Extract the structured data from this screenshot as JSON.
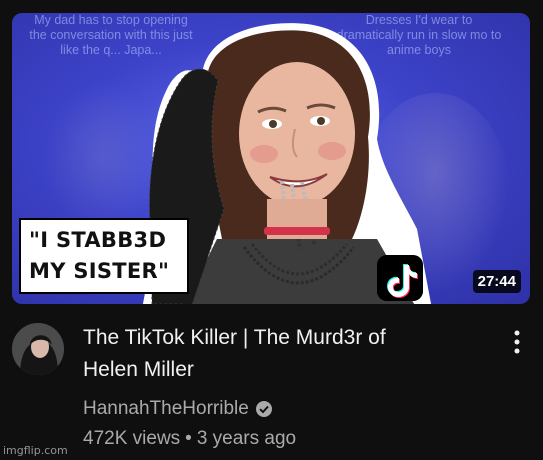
{
  "thumbnail": {
    "caption_left": "My dad has to stop opening the conversation with this just like the q... Japa...",
    "caption_right": "Dresses I'd wear to dramatically run in slow mo to anime boys",
    "quote_line1": "\"I STABB3D",
    "quote_line2": "MY SISTER\"",
    "duration": "27:44",
    "icon": "tiktok-icon"
  },
  "video": {
    "title_line1": "The TikTok Killer | The Murd3r of",
    "title_line2": "Helen Miller",
    "channel": "HannahTheHorrible",
    "views": "472K views",
    "separator": "•",
    "age": "3 years ago"
  },
  "watermark": "imgflip.com",
  "colors": {
    "background": "#0f0f0f",
    "title": "#f1f1f1",
    "meta": "#aaaaaa",
    "thumb_bg": "#3d43c9"
  }
}
